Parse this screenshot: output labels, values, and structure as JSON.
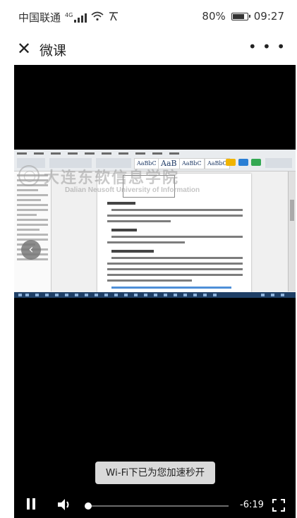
{
  "status_bar": {
    "carrier": "中国联通",
    "network": "4G",
    "battery": "80%",
    "time": "09:27"
  },
  "nav": {
    "close_icon": "close-icon",
    "title": "微课",
    "more_icon": "more-icon"
  },
  "video": {
    "watermark_cn": "大连东软信息学院",
    "watermark_en": "Dalian Neusoft University of Information",
    "toast": "Wi-Fi下已为您加速秒开",
    "time_remaining": "-6:19",
    "progress": 0.0,
    "icons": {
      "back": "chevron-left-icon",
      "play_pause": "pause-icon",
      "volume": "volume-icon",
      "fullscreen": "fullscreen-icon"
    }
  },
  "colors": {
    "video_bg": "#000000",
    "toast_bg": "#e6e6e6"
  }
}
